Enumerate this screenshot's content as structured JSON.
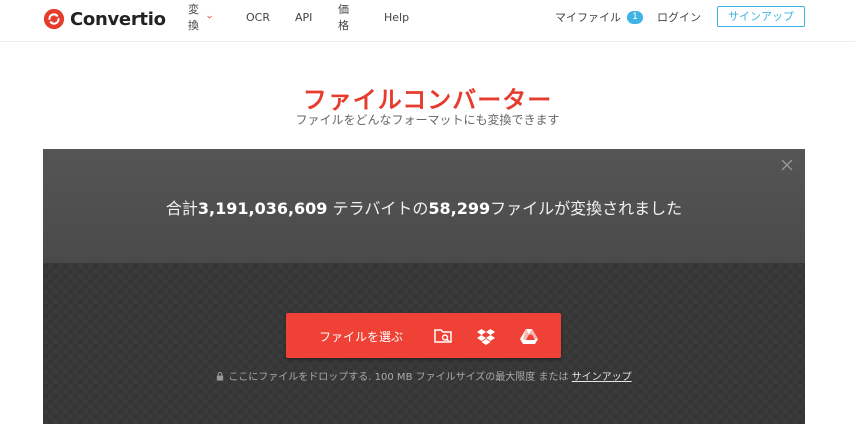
{
  "brand": {
    "name": "Convertio",
    "color": "#e53c2e"
  },
  "nav": {
    "items": [
      {
        "label": "変換",
        "has_dropdown": true
      },
      {
        "label": "OCR"
      },
      {
        "label": "API"
      },
      {
        "label": "価格"
      },
      {
        "label": "Help"
      }
    ]
  },
  "account": {
    "my_files_label": "マイファイル",
    "my_files_count": "1",
    "login_label": "ログイン",
    "signup_label": "サインアップ"
  },
  "hero": {
    "title": "ファイルコンバーター",
    "subtitle": "ファイルをどんなフォーマットにも変換できます"
  },
  "notice": {
    "prefix": "合計",
    "terabytes": "3,191,036,609",
    "middle": " テラバイトの",
    "files": "58,299",
    "suffix": "ファイルが変換されました"
  },
  "upload": {
    "choose_label": "ファイルを選ぶ",
    "sources": [
      "folder-search-icon",
      "dropbox-icon",
      "google-drive-icon"
    ],
    "drop_hint": "ここにファイルをドロップする. 100 MB ファイルサイズの最大限度 または",
    "drop_link": "サインアップ"
  },
  "colors": {
    "accent": "#ef4135",
    "link": "#3eb3e4"
  }
}
